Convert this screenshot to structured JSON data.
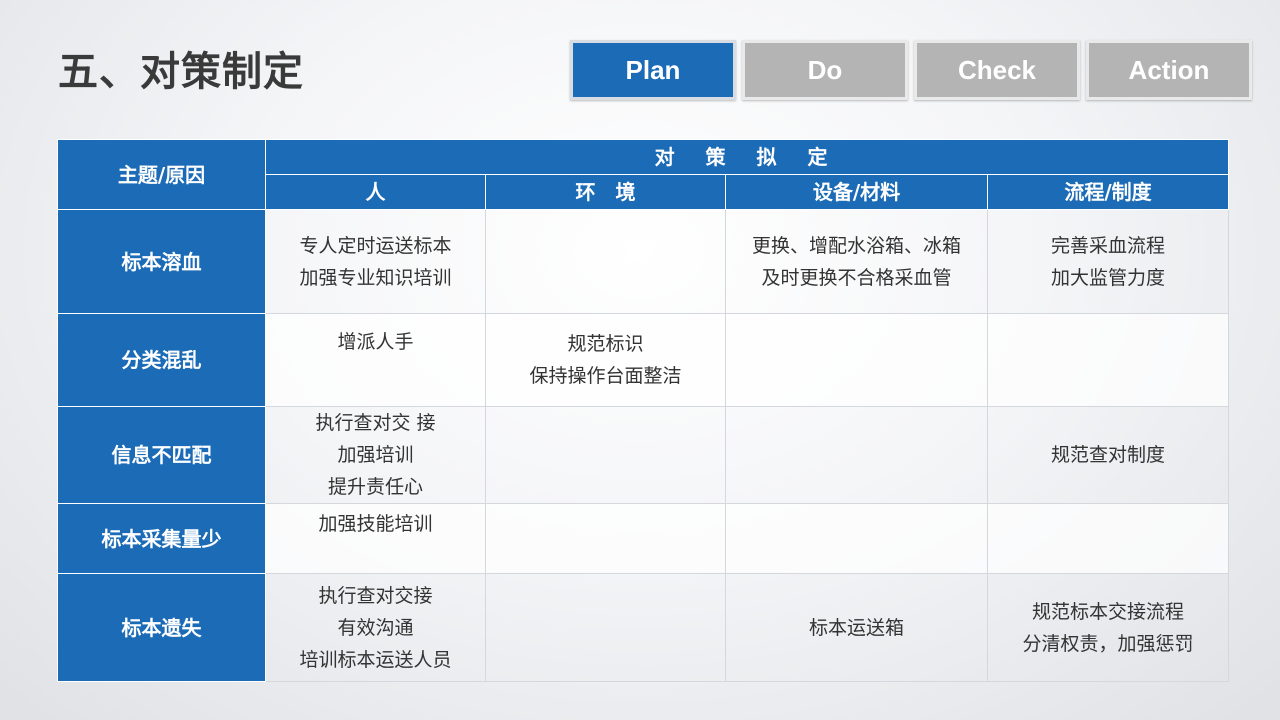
{
  "title": "五、对策制定",
  "pdca": {
    "plan": "Plan",
    "do": "Do",
    "check": "Check",
    "action": "Action"
  },
  "table": {
    "header_topic": "主题/原因",
    "header_measures": "对 策 拟 定",
    "columns": [
      "人",
      "环　境",
      "设备/材料",
      "流程/制度"
    ],
    "rows": [
      {
        "cause": "标本溶血",
        "person": [
          "专人定时运送标本",
          "加强专业知识培训"
        ],
        "environment": [],
        "equipment": [
          "更换、增配水浴箱、冰箱",
          "及时更换不合格采血管"
        ],
        "process": [
          "完善采血流程",
          "加大监管力度"
        ]
      },
      {
        "cause": "分类混乱",
        "person": [
          "增派人手"
        ],
        "environment": [
          "规范标识",
          "保持操作台面整洁"
        ],
        "equipment": [],
        "process": []
      },
      {
        "cause": "信息不匹配",
        "person": [
          "执行查对交 接",
          "加强培训",
          "提升责任心"
        ],
        "environment": [],
        "equipment": [],
        "process": [
          "规范查对制度"
        ]
      },
      {
        "cause": "标本采集量少",
        "person": [
          "加强技能培训"
        ],
        "environment": [],
        "equipment": [],
        "process": []
      },
      {
        "cause": "标本遗失",
        "person": [
          "执行查对交接",
          "有效沟通",
          "培训标本运送人员"
        ],
        "environment": [],
        "equipment": [
          "标本运送箱"
        ],
        "process": [
          "规范标本交接流程",
          "分清权责，加强惩罚"
        ]
      }
    ]
  },
  "colors": {
    "primary_blue": "#1b6bb6",
    "inactive_gray": "#b4b4b4",
    "title_text": "#3a3a3a"
  }
}
